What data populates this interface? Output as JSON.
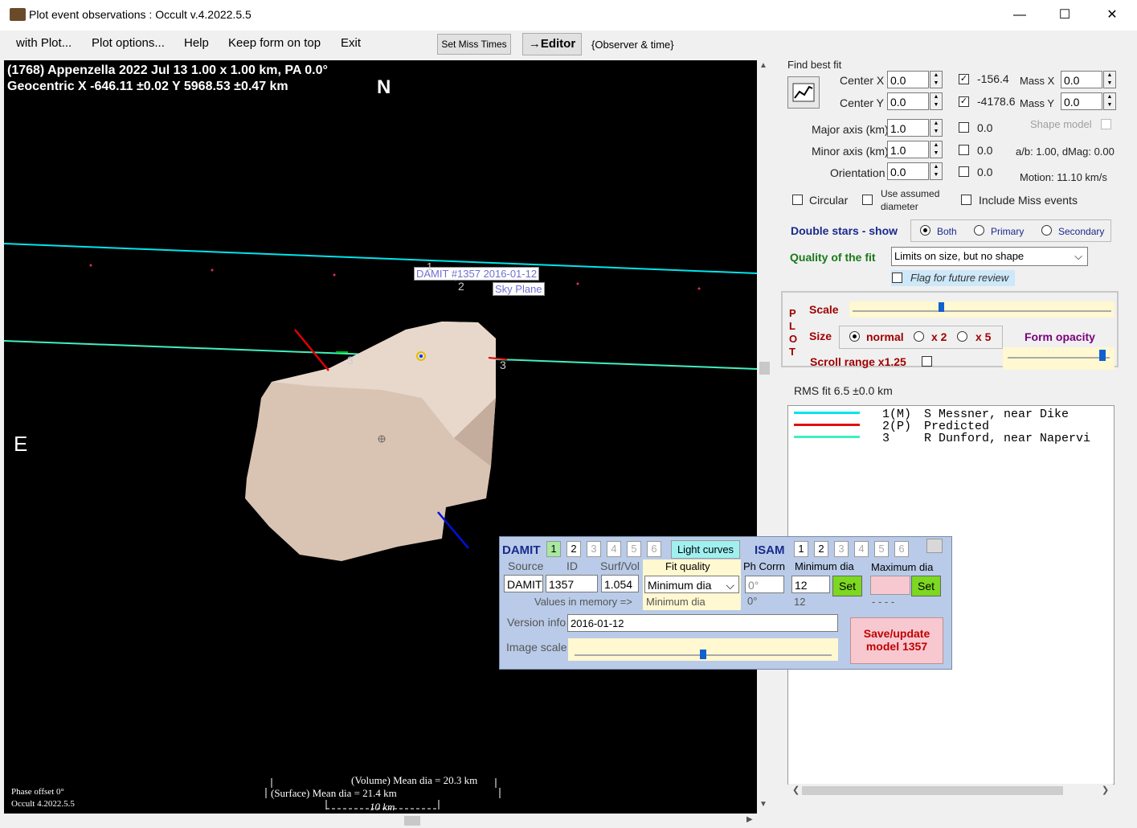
{
  "window": {
    "title": "Plot event observations : Occult v.4.2022.5.5",
    "minimize": "—",
    "maximize": "☐",
    "close": "✕"
  },
  "menu": {
    "items": [
      "with Plot...",
      "Plot options...",
      "Help",
      "Keep form on top",
      "Exit"
    ],
    "set_miss_times": "Set Miss Times",
    "editor": "→Editor",
    "observer_time": "{Observer & time}"
  },
  "plot": {
    "header_line1": "(1768) Appenzella  2022 Jul 13   1.00 x 1.00 km, PA 0.0°",
    "header_line2": "Geocentric  X  -646.11 ±0.02  Y 5968.53 ±0.47 km",
    "north": "N",
    "east": "E",
    "damit_label": "DAMIT #1357 2016-01-12",
    "sky_plane_label": "Sky Plane",
    "chord_labels": [
      "1",
      "2",
      "3",
      "3",
      "1"
    ],
    "phase_offset": "Phase offset 0°",
    "version": "Occult 4.2022.5.5",
    "volume_dia": "(Volume) Mean dia = 20.3 km",
    "surface_dia": "(Surface) Mean dia = 21.4 km",
    "scale_label": "10 km"
  },
  "fit": {
    "find_best_fit": "Find best fit",
    "center_x_label": "Center X",
    "center_x": "0.0",
    "center_y_label": "Center Y",
    "center_y": "0.0",
    "center_x_val": "-156.4",
    "center_y_val": "-4178.6",
    "mass_x_label": "Mass X",
    "mass_x": "0.0",
    "mass_y_label": "Mass Y",
    "mass_y": "0.0",
    "major_label": "Major axis (km)",
    "major": "1.0",
    "major_val": "0.0",
    "minor_label": "Minor axis (km)",
    "minor": "1.0",
    "minor_val": "0.0",
    "orient_label": "Orientation",
    "orient": "0.0",
    "orient_val": "0.0",
    "shape_model": "Shape model",
    "ab_text": "a/b: 1.00, dMag: 0.00",
    "motion": "Motion: 11.10 km/s",
    "circular": "Circular",
    "use_assumed": "Use assumed",
    "diameter": "diameter",
    "include_miss": "Include Miss events",
    "double_stars": "Double stars - show",
    "both": "Both",
    "primary": "Primary",
    "secondary": "Secondary",
    "quality_label": "Quality of the fit",
    "quality_value": "Limits on size, but no shape",
    "flag_review": "Flag for future review"
  },
  "plotopts": {
    "plot_letters": [
      "P",
      "L",
      "O",
      "T"
    ],
    "scale": "Scale",
    "scale_level": 0.34,
    "size": "Size",
    "normal": "normal",
    "x2": "x 2",
    "x5": "x 5",
    "form_opacity": "Form opacity",
    "opacity_level": 0.96,
    "scroll_range": "Scroll range x1.25"
  },
  "rms": "RMS fit 6.5 ±0.0 km",
  "legend": {
    "rows": [
      {
        "num": "1(M)",
        "name": "S Messner, near Dike",
        "color": "#00e5ee"
      },
      {
        "num": "2(P)",
        "name": "Predicted",
        "color": "#e01010"
      },
      {
        "num": "3",
        "name": "R Dunford, near Napervi",
        "color": "#40f0c0"
      }
    ]
  },
  "damit": {
    "damit_label": "DAMIT",
    "nums": [
      "1",
      "2",
      "3",
      "4",
      "5",
      "6"
    ],
    "light_curves": "Light curves",
    "isam_label": "ISAM",
    "source_label": "Source",
    "id_label": "ID",
    "surfvol_label": "Surf/Vol",
    "fitq_label": "Fit quality",
    "phcorr_label": "Ph Corrn",
    "mindia_label": "Minimum dia",
    "maxdia_label": "Maximum dia",
    "source": "DAMIT",
    "id": "1357",
    "surfvol": "1.054",
    "fitq": "Minimum dia",
    "phcorr": "0°",
    "mindia": "12",
    "set": "Set",
    "values_in_memory": "Values in memory =>",
    "mem_fitq": "Minimum dia",
    "mem_phcorr": "0°",
    "mem_mindia": "12",
    "mem_maxdia": "- - - -",
    "version_label": "Version info",
    "version": "2016-01-12",
    "image_scale_label": "Image scale",
    "image_scale_level": 0.5,
    "save_update": "Save/update",
    "model": "model  1357"
  }
}
